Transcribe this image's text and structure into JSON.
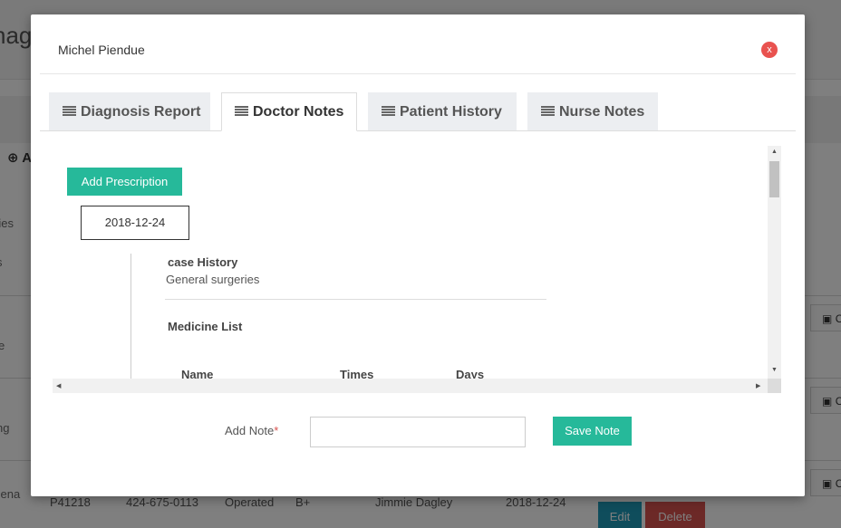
{
  "background": {
    "page_heading": "nag",
    "add_label": "A",
    "side_text_1": "ries",
    "side_text_2": "s",
    "side_text_3": "e",
    "side_text_4": "ng",
    "side_text_5": "sena",
    "right_button_icon": "money-icon",
    "right_button_label": "C",
    "row": {
      "id": "P41218",
      "phone": "424-675-0113",
      "status": "Operated",
      "blood": "B+",
      "doctor": "Jimmie Dagley",
      "date": "2018-12-24",
      "edit_label": "Edit",
      "delete_label": "Delete"
    }
  },
  "modal": {
    "title": "Michel Piendue",
    "close_label": "x",
    "tabs": [
      {
        "label": "Diagnosis Report",
        "icon": "list-icon",
        "active": false
      },
      {
        "label": "Doctor Notes",
        "icon": "list-icon",
        "active": true
      },
      {
        "label": "Patient History",
        "icon": "list-icon",
        "active": false
      },
      {
        "label": "Nurse Notes",
        "icon": "list-icon",
        "active": false
      }
    ],
    "doctor_notes": {
      "add_prescription_label": "Add Prescription",
      "date": "2018-12-24",
      "case_history_heading": "case History",
      "case_history_value": "General surgeries",
      "medicine_list_heading": "Medicine List",
      "table_headers": [
        "Name",
        "Times",
        "Days"
      ]
    },
    "add_note": {
      "label": "Add Note",
      "required_mark": "*",
      "value": "",
      "save_label": "Save Note"
    }
  },
  "colors": {
    "accent": "#26b99a",
    "close": "#e9524f",
    "edit": "#1f9bb8",
    "delete": "#d9534f"
  }
}
